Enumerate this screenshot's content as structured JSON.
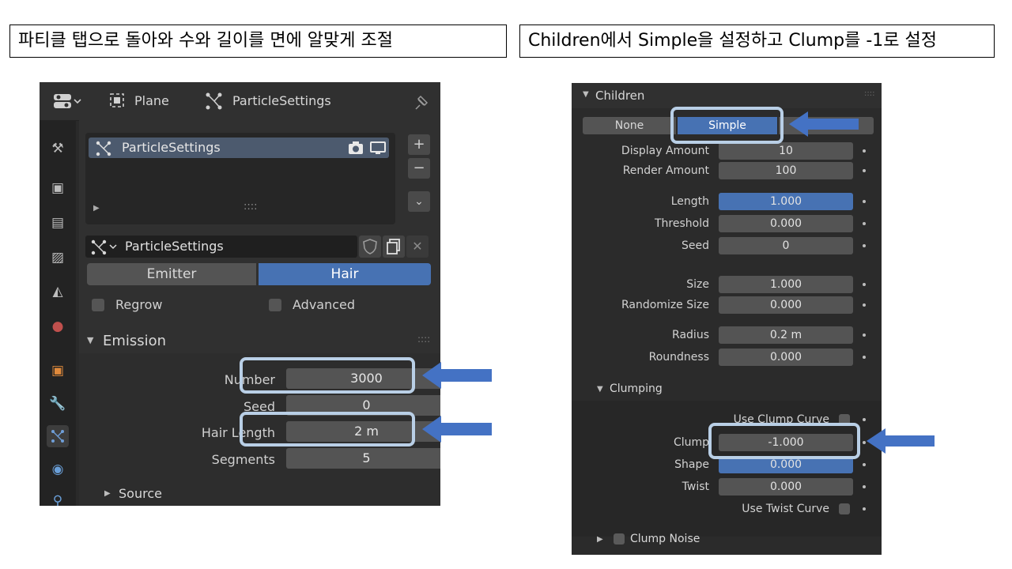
{
  "captions": {
    "left": "파티클 탭으로 돌아와 수와 길이를 면에 알맞게 조절",
    "right": "Children에서 Simple을 설정하고 Clump를 -1로 설정"
  },
  "left_panel": {
    "header": {
      "object_name": "Plane",
      "settings_name": "ParticleSettings"
    },
    "list": {
      "item": "ParticleSettings",
      "handle": "::::"
    },
    "datablock": {
      "name": "ParticleSettings"
    },
    "type_tabs": {
      "emitter": "Emitter",
      "hair": "Hair",
      "selected": "Hair"
    },
    "checkboxes": {
      "regrow": "Regrow",
      "advanced": "Advanced"
    },
    "emission": {
      "title": "Emission",
      "handle": "::::",
      "number_label": "Number",
      "number_value": "3000",
      "seed_label": "Seed",
      "seed_value": "0",
      "hair_length_label": "Hair Length",
      "hair_length_value": "2 m",
      "segments_label": "Segments",
      "segments_value": "5"
    },
    "source": {
      "title": "Source"
    },
    "colors": {
      "accent": "#4772b3",
      "highlight_border": "#b9cfe6",
      "arrow": "#4472c4"
    }
  },
  "right_panel": {
    "children": {
      "title": "Children",
      "handle": "::::",
      "mode_none": "None",
      "mode_simple": "Simple",
      "selected": "Simple",
      "display_amount_label": "Display Amount",
      "display_amount_value": "10",
      "render_amount_label": "Render Amount",
      "render_amount_value": "100",
      "length_label": "Length",
      "length_value": "1.000",
      "threshold_label": "Threshold",
      "threshold_value": "0.000",
      "seed_label": "Seed",
      "seed_value": "0",
      "size_label": "Size",
      "size_value": "1.000",
      "randomize_size_label": "Randomize Size",
      "randomize_size_value": "0.000",
      "radius_label": "Radius",
      "radius_value": "0.2 m",
      "roundness_label": "Roundness",
      "roundness_value": "0.000"
    },
    "clumping": {
      "title": "Clumping",
      "use_clump_curve_label": "Use Clump Curve",
      "clump_label": "Clump",
      "clump_value": "-1.000",
      "shape_label": "Shape",
      "shape_value": "0.000",
      "twist_label": "Twist",
      "twist_value": "0.000",
      "use_twist_curve_label": "Use Twist Curve"
    },
    "clump_noise": {
      "title": "Clump Noise"
    }
  }
}
